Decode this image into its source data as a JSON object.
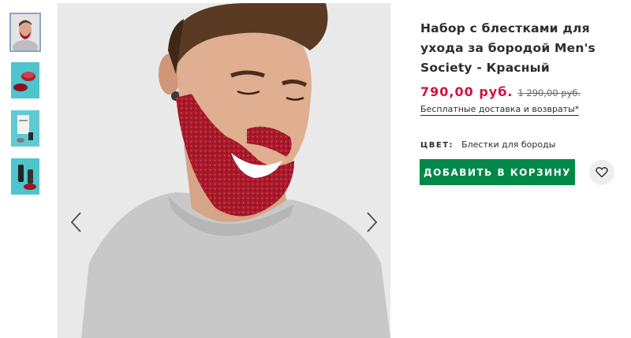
{
  "gallery": {
    "thumbnails": [
      {
        "name": "thumbnail-model",
        "active": true
      },
      {
        "name": "thumbnail-product-red",
        "active": false
      },
      {
        "name": "thumbnail-product-box",
        "active": false
      },
      {
        "name": "thumbnail-product-bottles",
        "active": false
      }
    ],
    "prev_icon": "chevron-left-icon",
    "next_icon": "chevron-right-icon"
  },
  "product": {
    "title": "Набор с блестками для ухода за бородой Men's Society - Красный",
    "price": "790,00 руб.",
    "old_price": "1 290,00 руб.",
    "delivery_text": "Бесплатные доставка и возвраты*",
    "color_label": "ЦВЕТ:",
    "color_value": "Блестки для бороды"
  },
  "actions": {
    "add_to_bag_label": "ДОБАВИТЬ В КОРЗИНУ",
    "favorite_icon": "heart-icon"
  },
  "colors": {
    "price": "#d01345",
    "button": "#018849",
    "text": "#2d2d2d",
    "beard_glitter": "#a8192a"
  }
}
